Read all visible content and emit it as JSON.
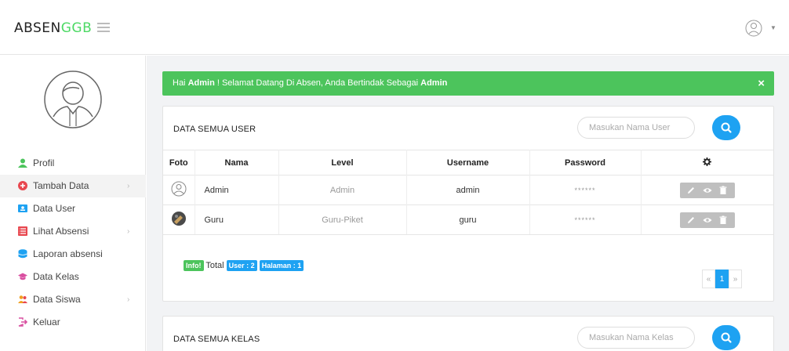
{
  "brand": {
    "main": "ABSEN",
    "accent": "GGB"
  },
  "sidebar": {
    "items": [
      {
        "label": "Profil",
        "icon": "user-icon"
      },
      {
        "label": "Tambah Data",
        "icon": "plus-circle-icon",
        "has_submenu": true
      },
      {
        "label": "Data User",
        "icon": "id-card-icon"
      },
      {
        "label": "Lihat Absensi",
        "icon": "list-icon",
        "has_submenu": true
      },
      {
        "label": "Laporan absensi",
        "icon": "database-icon"
      },
      {
        "label": "Data Kelas",
        "icon": "graduation-cap-icon"
      },
      {
        "label": "Data Siswa",
        "icon": "users-icon",
        "has_submenu": true
      },
      {
        "label": "Keluar",
        "icon": "sign-out-icon"
      }
    ]
  },
  "alert": {
    "prefix": "Hai ",
    "user": "Admin",
    "middle": " ! Selamat Datang Di Absen, Anda Bertindak Sebagai ",
    "role": "Admin",
    "close": "×"
  },
  "users_card": {
    "title": "DATA SEMUA USER",
    "search_placeholder": "Masukan Nama User",
    "columns": [
      "Foto",
      "Nama",
      "Level",
      "Username",
      "Password"
    ],
    "rows": [
      {
        "nama": "Admin",
        "level": "Admin",
        "username": "admin",
        "password": "******"
      },
      {
        "nama": "Guru",
        "level": "Guru-Piket",
        "username": "guru",
        "password": "******"
      }
    ],
    "info_badge": "Info!",
    "total_label": "Total",
    "user_badge": "User : 2",
    "page_badge": "Halaman : 1",
    "pager": {
      "prev": "«",
      "current": "1",
      "next": "»"
    }
  },
  "kelas_card": {
    "title": "DATA SEMUA KELAS",
    "search_placeholder": "Masukan Nama Kelas"
  },
  "colors": {
    "green": "#4cc45c",
    "blue": "#1ea2f2",
    "accent": "#4cd964"
  }
}
